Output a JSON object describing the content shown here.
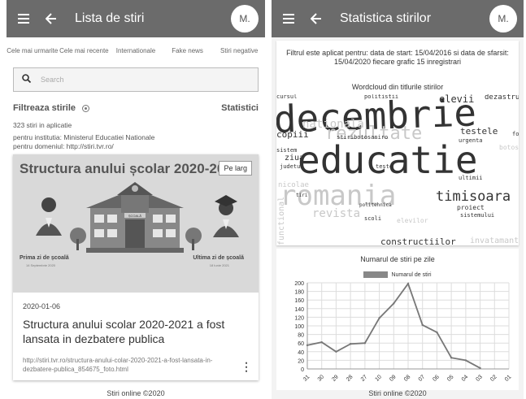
{
  "left": {
    "appbar": {
      "title": "Lista de stiri",
      "avatar": "M."
    },
    "tabs": [
      "Cele mai urmarite",
      "Cele mai recente",
      "Internationale",
      "Fake news",
      "Stiri negative"
    ],
    "search": {
      "placeholder": "Search"
    },
    "filter": {
      "title": "Filtreaza stirile",
      "stats_link": "Statistici"
    },
    "info": {
      "count": "323 stiri in aplicatie",
      "institution": "pentru institutia: Ministerul Educatiei Nationale",
      "domain": "pentru domeniul: http://stiri.tvr.ro/"
    },
    "card": {
      "image_headline": "Structura anului școlar 2020-2021",
      "image_caption_left": "Prima zi de școală",
      "image_caption_left_date": "14 Septembrie 2020",
      "image_caption_right": "Ultima zi de școală",
      "image_caption_right_date": "18 Iunie 2021",
      "image_school_sign": "ȘCOALĂ",
      "button": "Pe larg",
      "date": "2020-01-06",
      "title": "Structura anului scolar 2020-2021 a fost lansata in dezbatere publica",
      "url": "http://stiri.tvr.ro/structura-anului-colar-2020-2021-a-fost-lansata-in-dezbatere-publica_854675_foto.html"
    },
    "footer": "Stiri online ©2020"
  },
  "right": {
    "appbar": {
      "title": "Statistica stirilor",
      "avatar": "M."
    },
    "info": "Filtrul este aplicat pentru: data de start: 15/04/2016 si data de sfarsit: 15/04/2020 fiecare grafic 15 inregistrari",
    "wordcloud_title": "Wordcloud din titlurile stirilor",
    "wordcloud_words": [
      {
        "text": "decembrie",
        "tone": "dark",
        "weight": 10
      },
      {
        "text": "educatie",
        "tone": "dark",
        "weight": 9
      },
      {
        "text": "romania",
        "tone": "light",
        "weight": 6
      },
      {
        "text": "rezultate",
        "tone": "light",
        "weight": 5
      },
      {
        "text": "timisoara",
        "tone": "dark",
        "weight": 4
      },
      {
        "text": "elevii",
        "tone": "dark",
        "weight": 3
      },
      {
        "text": "testele",
        "tone": "dark",
        "weight": 2
      },
      {
        "text": "copiii",
        "tone": "dark",
        "weight": 2
      },
      {
        "text": "constructiilor",
        "tone": "dark",
        "weight": 2
      },
      {
        "text": "stiribotosaniro",
        "tone": "dark",
        "weight": 1
      },
      {
        "text": "dezastru",
        "tone": "dark",
        "weight": 1
      },
      {
        "text": "proiect",
        "tone": "dark",
        "weight": 1
      },
      {
        "text": "ziua",
        "tone": "dark",
        "weight": 1
      },
      {
        "text": "nationala",
        "tone": "light",
        "weight": 2
      },
      {
        "text": "revista",
        "tone": "light",
        "weight": 2
      },
      {
        "text": "functional",
        "tone": "light",
        "weight": 1
      },
      {
        "text": "invatamant",
        "tone": "light",
        "weight": 1
      },
      {
        "text": "nicolae",
        "tone": "light",
        "weight": 1
      },
      {
        "text": "elevilor",
        "tone": "light",
        "weight": 1
      },
      {
        "text": "politistii",
        "tone": "dark",
        "weight": 1
      },
      {
        "text": "cursul",
        "tone": "dark",
        "weight": 1
      },
      {
        "text": "judetul",
        "tone": "dark",
        "weight": 1
      },
      {
        "text": "urgenta",
        "tone": "dark",
        "weight": 1
      },
      {
        "text": "scoli",
        "tone": "dark",
        "weight": 1
      },
      {
        "text": "sistemului",
        "tone": "dark",
        "weight": 1
      },
      {
        "text": "ultimii",
        "tone": "dark",
        "weight": 1
      },
      {
        "text": "botosani",
        "tone": "light",
        "weight": 1
      },
      {
        "text": "politehnica",
        "tone": "dark",
        "weight": 1
      },
      {
        "text": "tiri",
        "tone": "dark",
        "weight": 1
      },
      {
        "text": "foto",
        "tone": "dark",
        "weight": 1
      },
      {
        "text": "teste",
        "tone": "dark",
        "weight": 1
      },
      {
        "text": "sistem",
        "tone": "dark",
        "weight": 1
      },
      {
        "text": "comanese",
        "tone": "light",
        "weight": 1
      }
    ],
    "chart_title": "Numarul de stiri pe zile",
    "footer": "Stiri online ©2020"
  },
  "chart_data": {
    "type": "line",
    "title": "Numarul de stiri pe zile",
    "xlabel": "",
    "ylabel": "",
    "categories": [
      "31",
      "30",
      "29",
      "28",
      "27",
      "10",
      "09",
      "08",
      "07",
      "06",
      "05",
      "04",
      "03",
      "02",
      "01"
    ],
    "series": [
      {
        "name": "Numarul de stiri",
        "values": [
          55,
          62,
          40,
          58,
          60,
          118,
          152,
          198,
          102,
          85,
          26,
          20,
          2,
          null,
          null
        ]
      }
    ],
    "yticks": [
      0,
      20,
      40,
      60,
      80,
      100,
      120,
      140,
      160,
      180,
      200
    ],
    "ylim": [
      0,
      200
    ],
    "grid": true,
    "legend": "top-center",
    "colors": {
      "line": "#777777",
      "legend_swatch": "#888888"
    }
  },
  "colors": {
    "appbar": "#6b6b6b",
    "background": "#ffffff",
    "panel_bg": "#f3f3f3"
  }
}
